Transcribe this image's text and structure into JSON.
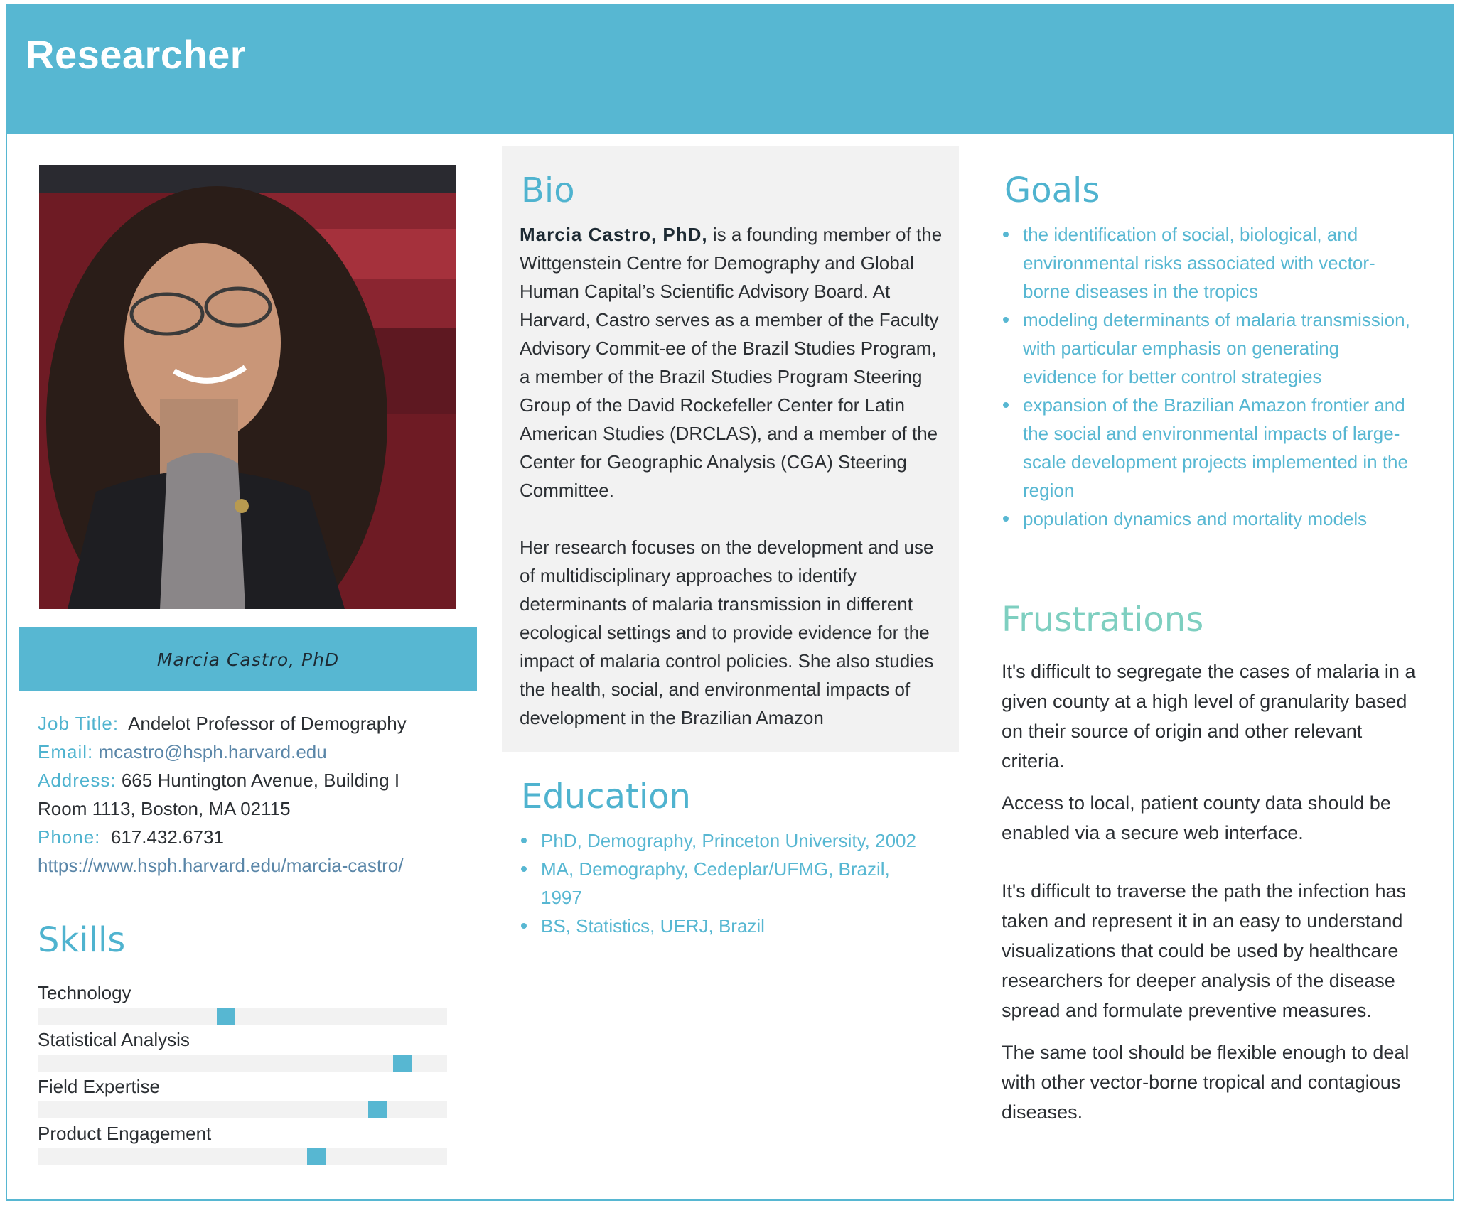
{
  "header": {
    "title": "Researcher"
  },
  "profile": {
    "name": "Marcia Castro, PhD",
    "job_title_label": "Job Title:",
    "job_title": "Andelot Professor of Demography",
    "email_label": "Email:",
    "email": "mcastro@hsph.harvard.edu",
    "address_label": "Address:",
    "address_line1": "665 Huntington Avenue, Building I",
    "address_line2": "Room 1113, Boston, MA 02115",
    "phone_label": "Phone:",
    "phone": "617.432.6731",
    "website": "https://www.hsph.harvard.edu/marcia-castro/"
  },
  "skills": {
    "title": "Skills",
    "items": [
      {
        "label": "Technology",
        "level": 0.46
      },
      {
        "label": "Statistical Analysis",
        "level": 0.89
      },
      {
        "label": "Field Expertise",
        "level": 0.83
      },
      {
        "label": "Product Engagement",
        "level": 0.68
      }
    ]
  },
  "bio": {
    "title": "Bio",
    "name_bold": "Marcia Castro, PhD,",
    "paragraph1_rest": " is a founding member of the Wittgenstein Centre for Demography and Global Human Capital’s Scientific Advisory Board. At Harvard, Castro serves as a member of the Faculty Advisory Commit-ee of the Brazil Studies Program, a member of the Brazil Studies Program Steering Group of the David Rockefeller Center for Latin American Studies (DRCLAS), and a member of the Center for Geographic Analysis (CGA) Steering Committee.",
    "paragraph2": "Her research focuses on the development and use of multidisciplinary approaches to identify determinants of malaria transmission in different ecological settings and to provide evidence for the impact of malaria control policies. She also studies the health, social, and environmental impacts of development in the Brazilian Amazon"
  },
  "education": {
    "title": "Education",
    "items": [
      "PhD, Demography, Princeton University, 2002",
      "MA, Demography, Cedeplar/UFMG, Brazil, 1997",
      "BS, Statistics, UERJ, Brazil"
    ]
  },
  "goals": {
    "title": "Goals",
    "items": [
      "the identification of social, biological, and environmental risks associated with vector-borne diseases in the tropics",
      "modeling determinants of malaria transmission, with particular emphasis on generating evidence for better control strategies",
      "expansion of the Brazilian Amazon frontier and the social and environmental impacts of large-scale development projects implemented in the region",
      "population dynamics and mortality models"
    ]
  },
  "frustrations": {
    "title": "Frustrations",
    "paragraphs": [
      "It's difficult to segregate the cases of malaria in a given county at a high level of granularity based on their source of origin and other relevant criteria.",
      "Access to local, patient county data should be enabled via a secure web interface.",
      "It's difficult to traverse the path the infection has taken and represent it in an easy to understand visualizations that could be used by healthcare researchers for deeper analysis of the disease spread and formulate preventive measures.",
      "The same tool should be flexible enough to deal with other vector-borne tropical and contagious diseases."
    ]
  },
  "colors": {
    "accent": "#57b7d2",
    "frustrations_title": "#7ecfc0",
    "panel": "#f2f2f2"
  }
}
